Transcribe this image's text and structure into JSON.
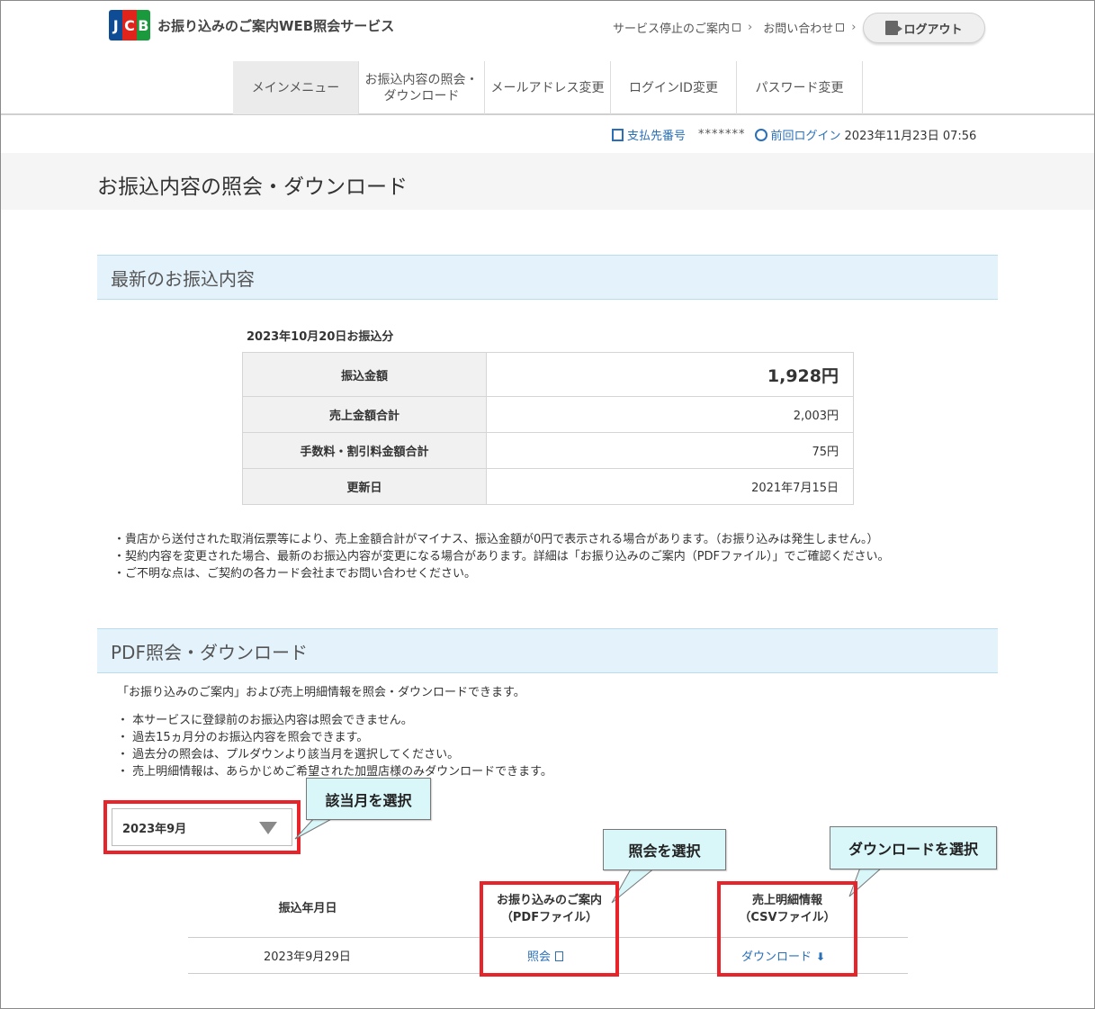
{
  "header": {
    "brand": "JCB",
    "service_title": "お振り込みのご案内WEB照会サービス",
    "links": [
      "サービス停止のご案内",
      "お問い合わせ"
    ],
    "logout": "ログアウト"
  },
  "nav": [
    {
      "label": "メインメニュー",
      "active": true
    },
    {
      "label": "お振込内容の照会・ダウンロード",
      "active": false
    },
    {
      "label": "メールアドレス変更",
      "active": false
    },
    {
      "label": "ログインID変更",
      "active": false
    },
    {
      "label": "パスワード変更",
      "active": false
    }
  ],
  "info": {
    "payee_label": "支払先番号",
    "payee_value": "*******",
    "last_login_label": "前回ログイン",
    "last_login_value": "2023年11月23日 07:56"
  },
  "page_title": "お振込内容の照会・ダウンロード",
  "latest": {
    "heading": "最新のお振込内容",
    "date_label": "2023年10月20日お振込分",
    "rows": [
      {
        "label": "振込金額",
        "value": "1,928円"
      },
      {
        "label": "売上金額合計",
        "value": "2,003円"
      },
      {
        "label": "手数料・割引料金額合計",
        "value": "75円"
      },
      {
        "label": "更新日",
        "value": "2021年7月15日"
      }
    ],
    "notes": [
      "・貴店から送付された取消伝票等により、売上金額合計がマイナス、振込金額が0円で表示される場合があります。（お振り込みは発生しません。）",
      "・契約内容を変更された場合、最新のお振込内容が変更になる場合があります。詳細は「お振り込みのご案内（PDFファイル）」でご確認ください。",
      "・ご不明な点は、ご契約の各カード会社までお問い合わせください。"
    ]
  },
  "pdf": {
    "heading": "PDF照会・ダウンロード",
    "intro": "「お振り込みのご案内」および売上明細情報を照会・ダウンロードできます。",
    "notes": [
      "・ 本サービスに登録前のお振込内容は照会できません。",
      "・ 過去15ヵ月分のお振込内容を照会できます。",
      "・ 過去分の照会は、プルダウンより該当月を選択してください。",
      "・ 売上明細情報は、あらかじめご希望された加盟店様のみダウンロードできます。"
    ],
    "selected_month": "2023年9月",
    "col_date": "振込年月日",
    "col_pdf_1": "お振り込みのご案内",
    "col_pdf_2": "（PDFファイル）",
    "col_csv_1": "売上明細情報",
    "col_csv_2": "（CSVファイル）",
    "row_date": "2023年9月29日",
    "view_link": "照会",
    "download_link": "ダウンロード"
  },
  "callouts": {
    "month": "該当月を選択",
    "view": "照会を選択",
    "download": "ダウンロードを選択"
  },
  "colors": {
    "accent_blue": "#2a6fb8",
    "highlight_red": "#e8242a",
    "section_bg": "#e3f2fb",
    "callout_bg": "#d9f6f9"
  }
}
